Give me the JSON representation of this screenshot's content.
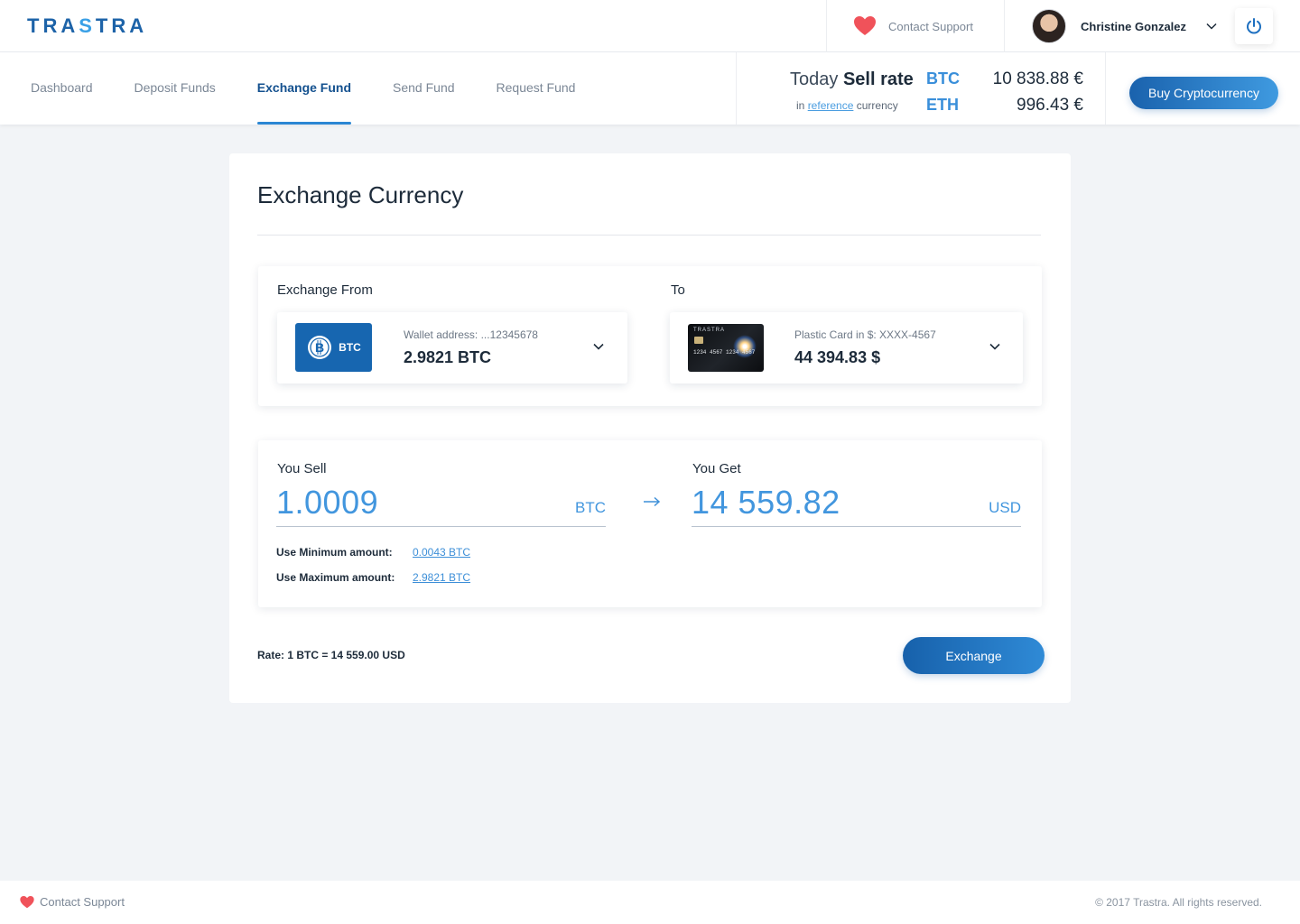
{
  "brand": {
    "logo_pre": "TRA",
    "logo_accent": "S",
    "logo_post": "TRA"
  },
  "header": {
    "support_label": "Contact Support",
    "user_name": "Christine Gonzalez"
  },
  "nav": {
    "tabs": [
      {
        "label": "Dashboard"
      },
      {
        "label": "Deposit Funds"
      },
      {
        "label": "Exchange Fund"
      },
      {
        "label": "Send Fund"
      },
      {
        "label": "Request Fund"
      }
    ],
    "active_tab": "Exchange Fund"
  },
  "rates": {
    "title_pre": "Today",
    "title_bold": "Sell rate",
    "sub_pre": "in",
    "sub_link": "reference",
    "sub_post": "currency",
    "rows": [
      {
        "currency": "BTC",
        "value": "10 838.88 €"
      },
      {
        "currency": "ETH",
        "value": "996.43 €"
      }
    ]
  },
  "buy_button": "Buy Cryptocurrency",
  "exchange": {
    "title": "Exchange Currency",
    "from_label": "Exchange From",
    "to_label": "To",
    "from": {
      "badge": "BTC",
      "sub": "Wallet address: ...12345678",
      "value": "2.9821 BTC"
    },
    "to": {
      "card_brand": "TRASTRA",
      "card_number": "1234 4567 1234 4567",
      "sub": "Plastic Card in $: XXXX-4567",
      "value": "44 394.83 $"
    },
    "sell": {
      "label": "You Sell",
      "amount": "1.0009",
      "currency": "BTC"
    },
    "get": {
      "label": "You Get",
      "amount": "14 559.82",
      "currency": "USD"
    },
    "min_label": "Use Minimum amount:",
    "min_value": "0.0043 BTC",
    "max_label": "Use Maximum amount:",
    "max_value": "2.9821 BTC",
    "rate_text": "Rate: 1 BTC = 14 559.00 USD",
    "button": "Exchange"
  },
  "footer": {
    "support_label": "Contact Support",
    "copyright": "© 2017 Trastra. All rights reserved."
  },
  "colors": {
    "accent": "#3a8fda",
    "brand_dark": "#1766b0",
    "heart": "#f0525a",
    "background": "#f2f4f7"
  }
}
